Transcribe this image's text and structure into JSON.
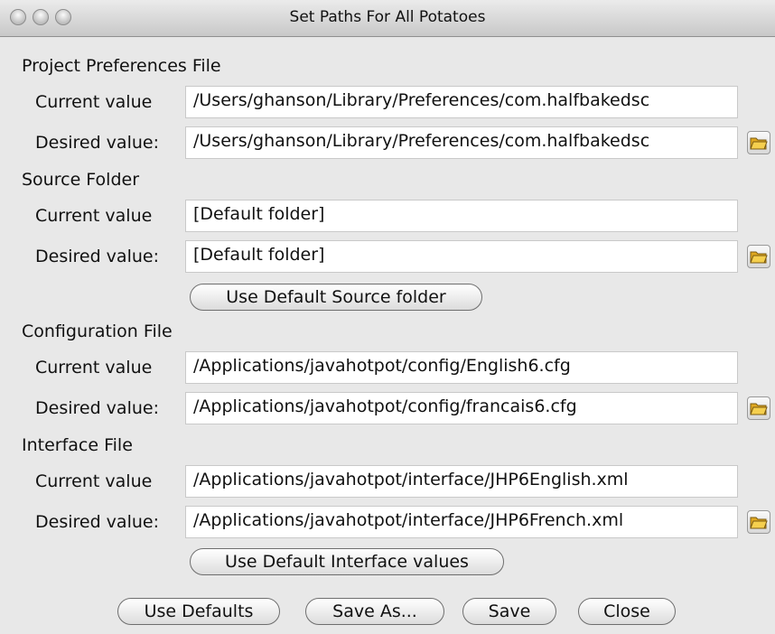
{
  "window": {
    "title": "Set Paths For All Potatoes"
  },
  "sections": {
    "project": {
      "heading": "Project Preferences File",
      "current_label": "Current value",
      "current_value": "/Users/ghanson/Library/Preferences/com.halfbakedsc",
      "desired_label": "Desired value:",
      "desired_value": "/Users/ghanson/Library/Preferences/com.halfbakedsc"
    },
    "source": {
      "heading": "Source Folder",
      "current_label": "Current value",
      "current_value": "[Default folder]",
      "desired_label": "Desired value:",
      "desired_value": "[Default folder]",
      "default_button": "Use Default Source folder"
    },
    "config": {
      "heading": "Configuration File",
      "current_label": "Current value",
      "current_value": "/Applications/javahotpot/config/English6.cfg",
      "desired_label": "Desired value:",
      "desired_value": "/Applications/javahotpot/config/francais6.cfg"
    },
    "interface": {
      "heading": "Interface File",
      "current_label": "Current value",
      "current_value": "/Applications/javahotpot/interface/JHP6English.xml",
      "desired_label": "Desired value:",
      "desired_value": "/Applications/javahotpot/interface/JHP6French.xml",
      "default_button": "Use Default Interface values"
    }
  },
  "footer": {
    "use_defaults": "Use Defaults",
    "save_as": "Save As...",
    "save": "Save",
    "close": "Close"
  },
  "icons": {
    "browse": "folder-open-icon"
  }
}
